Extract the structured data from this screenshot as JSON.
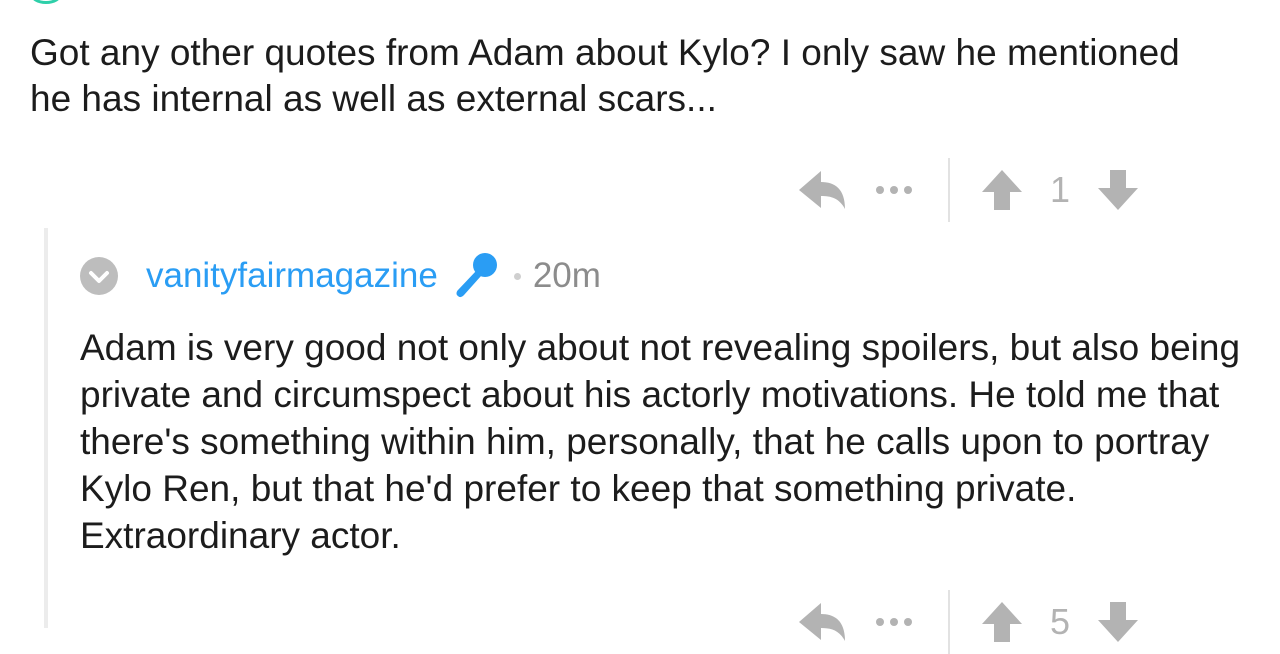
{
  "parent_comment": {
    "body": "Got any other quotes from Adam about Kylo? I only saw he mentioned he has internal as well as external scars...",
    "score": "1",
    "icons": [
      "reply-icon",
      "more-icon",
      "upvote-icon",
      "downvote-icon"
    ]
  },
  "reply_comment": {
    "author": "vanityfairmagazine",
    "flair_icon": "microphone-icon",
    "age": "20m",
    "body": "Adam is very good not only about not revealing spoilers, but also being private and circumspect about his actorly motivations. He told me that there's something within him, personally, that he calls upon to portray Kylo Ren, but that he'd prefer to keep that something private. Extraordinary actor.",
    "score": "5"
  },
  "colors": {
    "author_blue": "#2a9df4",
    "icon_gray": "#b3b3b3",
    "thread_line": "#ececec",
    "accent_teal": "#2ecfa9"
  }
}
